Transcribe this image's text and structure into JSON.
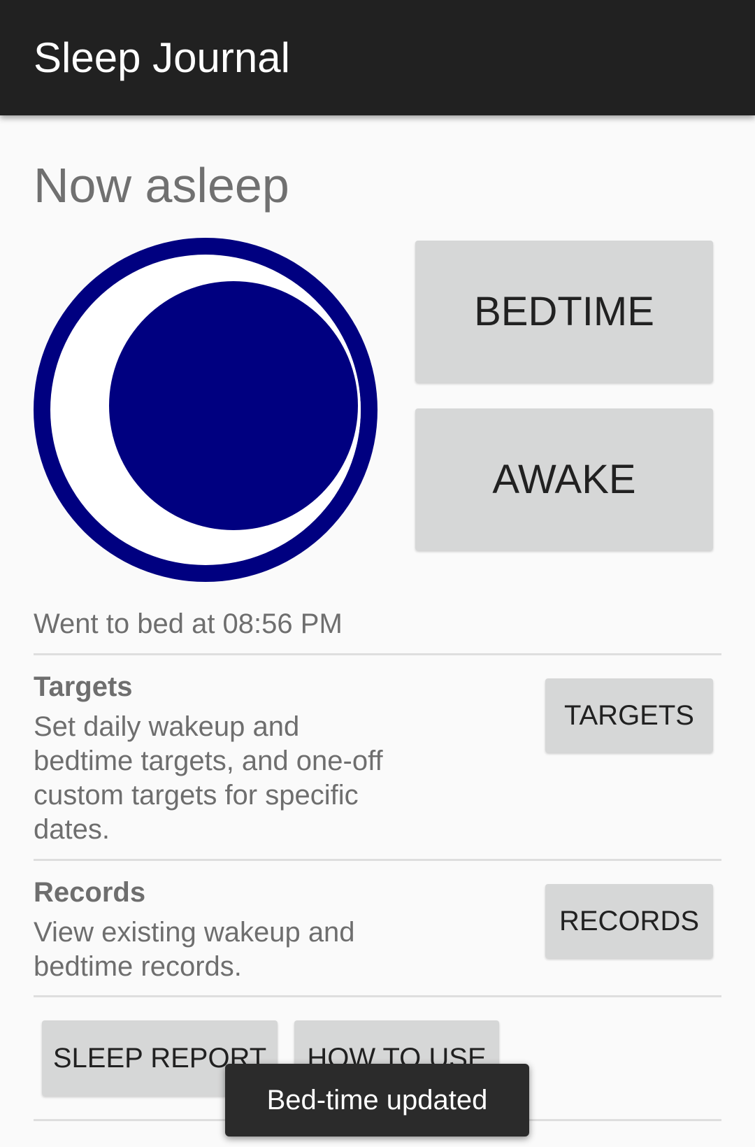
{
  "app_bar": {
    "title": "Sleep Journal"
  },
  "status": {
    "title": "Now asleep",
    "icon": "moon-icon",
    "bed_time_text": "Went to bed at 08:56 PM"
  },
  "actions": {
    "bedtime_label": "BEDTIME",
    "awake_label": "AWAKE"
  },
  "sections": {
    "targets": {
      "title": "Targets",
      "description": "Set daily wakeup and bedtime targets, and one-off custom targets for specific dates.",
      "button_label": "TARGETS"
    },
    "records": {
      "title": "Records",
      "description": "View existing wakeup and bedtime records.",
      "button_label": "RECORDS"
    }
  },
  "footer_buttons": {
    "sleep_report_label": "SLEEP REPORT",
    "how_to_use_label": "HOW TO USE"
  },
  "toast": {
    "message": "Bed-time updated"
  },
  "colors": {
    "app_bar": "#212121",
    "moon": "#000080",
    "button": "#d6d7d7",
    "background": "#fafafa"
  }
}
